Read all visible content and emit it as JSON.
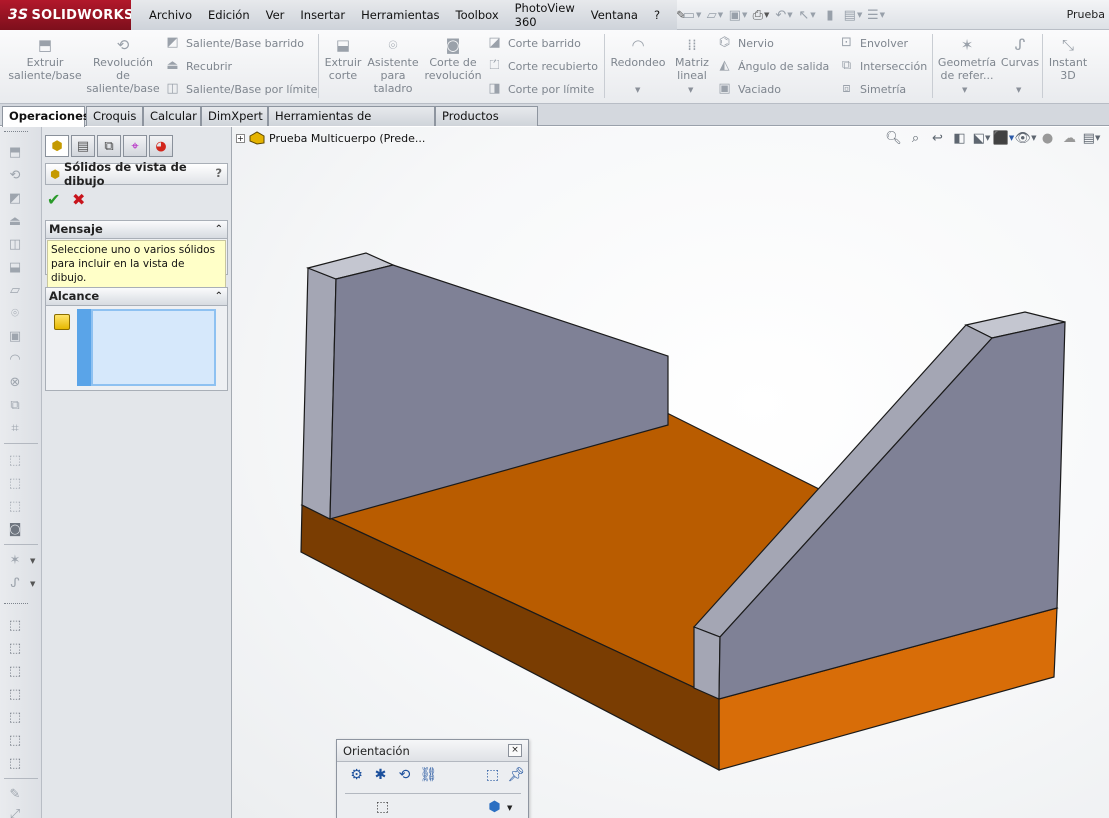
{
  "app": {
    "brand_prefix": "3S",
    "brand": "SOLIDWORKS",
    "document_title": "Prueba"
  },
  "menu": [
    "Archivo",
    "Edición",
    "Ver",
    "Insertar",
    "Herramientas",
    "Toolbox",
    "PhotoView 360",
    "Ventana",
    "?"
  ],
  "ribbon": {
    "extrude_boss": "Extruir saliente/base",
    "revolve_boss": "Revolución de saliente/base",
    "swept_boss": "Saliente/Base barrido",
    "loft": "Recubrir",
    "boundary_boss": "Saliente/Base por límite",
    "extrude_cut": "Extruir corte",
    "hole_wizard": "Asistente para taladro",
    "revolve_cut": "Corte de revolución",
    "swept_cut": "Corte barrido",
    "lofted_cut": "Corte recubierto",
    "boundary_cut": "Corte por límite",
    "fillet": "Redondeo",
    "linear_pattern": "Matriz lineal",
    "rib": "Nervio",
    "draft": "Ángulo de salida",
    "shell": "Vaciado",
    "wrap": "Envolver",
    "intersect": "Intersección",
    "mirror": "Simetría",
    "ref_geometry": "Geometría de refer...",
    "curves": "Curvas",
    "instant3d": "Instant 3D"
  },
  "tabs": [
    "Operaciones",
    "Croquis",
    "Calcular",
    "DimXpert",
    "Herramientas de renderizado",
    "Productos Office"
  ],
  "property_manager": {
    "title": "Sólidos de vista de dibujo",
    "help": "?",
    "message_header": "Mensaje",
    "message_text": "Seleccione uno o varios sólidos para incluir en la vista de dibujo.",
    "scope_header": "Alcance"
  },
  "feature_tree": {
    "root_label": "Prueba Multicuerpo  (Prede..."
  },
  "orientation": {
    "title": "Orientación",
    "close": "×"
  },
  "colors": {
    "base_top": "#b95c00",
    "base_front": "#d86d08",
    "base_side": "#7a3d02",
    "wall_face": "#7f8196",
    "wall_side": "#a4a6b4",
    "wall_top": "#c4c6d0",
    "brand_red": "#b2182b",
    "message_bg": "#ffffc8"
  }
}
